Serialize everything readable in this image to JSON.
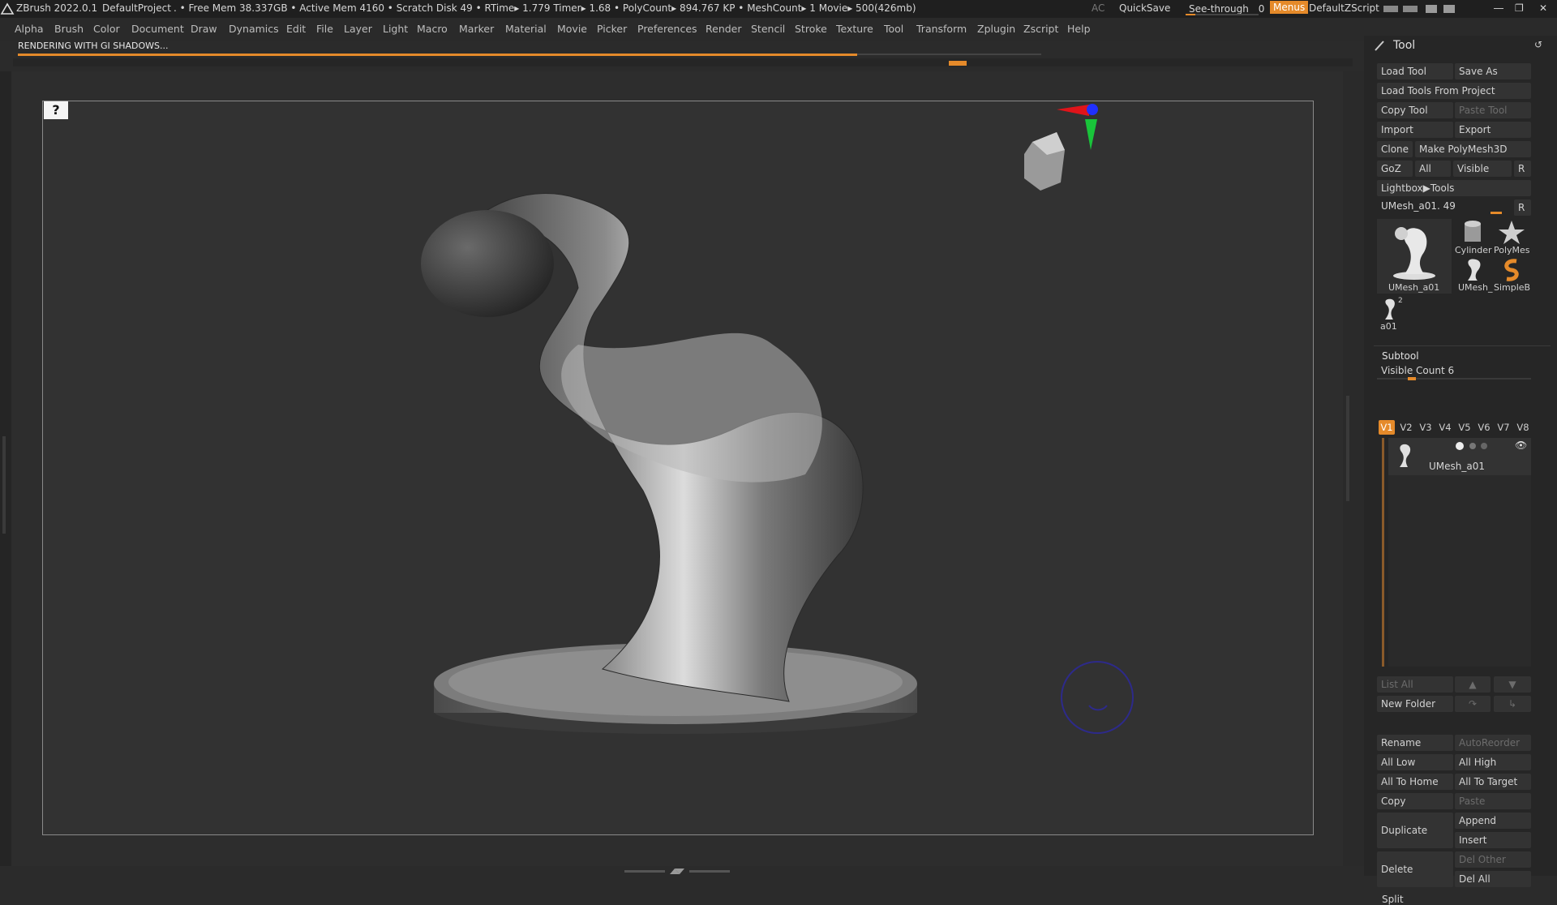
{
  "titlebar": {
    "app": "ZBrush 2022.0.1",
    "project": "DefaultProject",
    "stats": ". • Free Mem 38.337GB • Active Mem 4160 • Scratch Disk 49 •  RTime▸ 1.779 Timer▸ 1.68 • PolyCount▸ 894.767 KP  • MeshCount▸ 1  Movie▸ 500(426mb)",
    "ac": "AC",
    "quicksave": "QuickSave",
    "see_through": "See-through",
    "see_through_value": "0",
    "menus": "Menus",
    "zscript": "DefaultZScript"
  },
  "menubar": {
    "items": [
      "Alpha",
      "Brush",
      "Color",
      "Document",
      "Draw",
      "Dynamics",
      "Edit",
      "File",
      "Layer",
      "Light",
      "Macro",
      "Marker",
      "Material",
      "Movie",
      "Picker",
      "Preferences",
      "Render",
      "Stencil",
      "Stroke",
      "Texture",
      "Tool",
      "Transform",
      "Zplugin",
      "Zscript",
      "Help"
    ]
  },
  "status": {
    "rendering": "RENDERING WITH GI SHADOWS...",
    "progress": 0.82
  },
  "tool_panel": {
    "title": "Tool",
    "buttons": {
      "load_tool": "Load Tool",
      "save_as": "Save As",
      "load_tools_from_project": "Load Tools From Project",
      "copy_tool": "Copy Tool",
      "paste_tool": "Paste Tool",
      "import": "Import",
      "export": "Export",
      "clone": "Clone",
      "make_polymesh": "Make PolyMesh3D",
      "goz": "GoZ",
      "all": "All",
      "visible": "Visible",
      "r": "R",
      "lightbox_tools": "Lightbox▶Tools"
    },
    "current_tool": "UMesh_a01. 49",
    "current_tool_r": "R",
    "thumbnails": {
      "main": "UMesh_a01",
      "cylinder": "Cylinder",
      "polymesh": "PolyMes",
      "umesh_small": "UMesh_",
      "simpleb": "SimpleB",
      "a01": "a01",
      "a01_count": "2"
    }
  },
  "subtool": {
    "title": "Subtool",
    "visible_count_label": "Visible Count 6",
    "visible_count": 6,
    "tabs": [
      "V1",
      "V2",
      "V3",
      "V4",
      "V5",
      "V6",
      "V7",
      "V8"
    ],
    "active_tab": "V1",
    "items": [
      {
        "name": "UMesh_a01"
      }
    ],
    "list_all": "List All",
    "new_folder": "New Folder",
    "rename": "Rename",
    "autoreorder": "AutoReorder",
    "all_low": "All Low",
    "all_high": "All High",
    "all_to_home": "All To Home",
    "all_to_target": "All To Target",
    "copy": "Copy",
    "paste": "Paste",
    "duplicate": "Duplicate",
    "append": "Append",
    "insert": "Insert",
    "delete": "Delete",
    "del_other": "Del Other",
    "del_all": "Del All",
    "split": "Split"
  },
  "colors": {
    "accent": "#e58a2a",
    "panel": "#262626",
    "button": "#333333"
  },
  "icons": {
    "help": "help-question-icon",
    "tool": "brush-tool-icon",
    "refresh": "refresh-icon",
    "orientation_gizmo": "axis-gizmo-icon",
    "eye": "eye-visibility-icon"
  }
}
